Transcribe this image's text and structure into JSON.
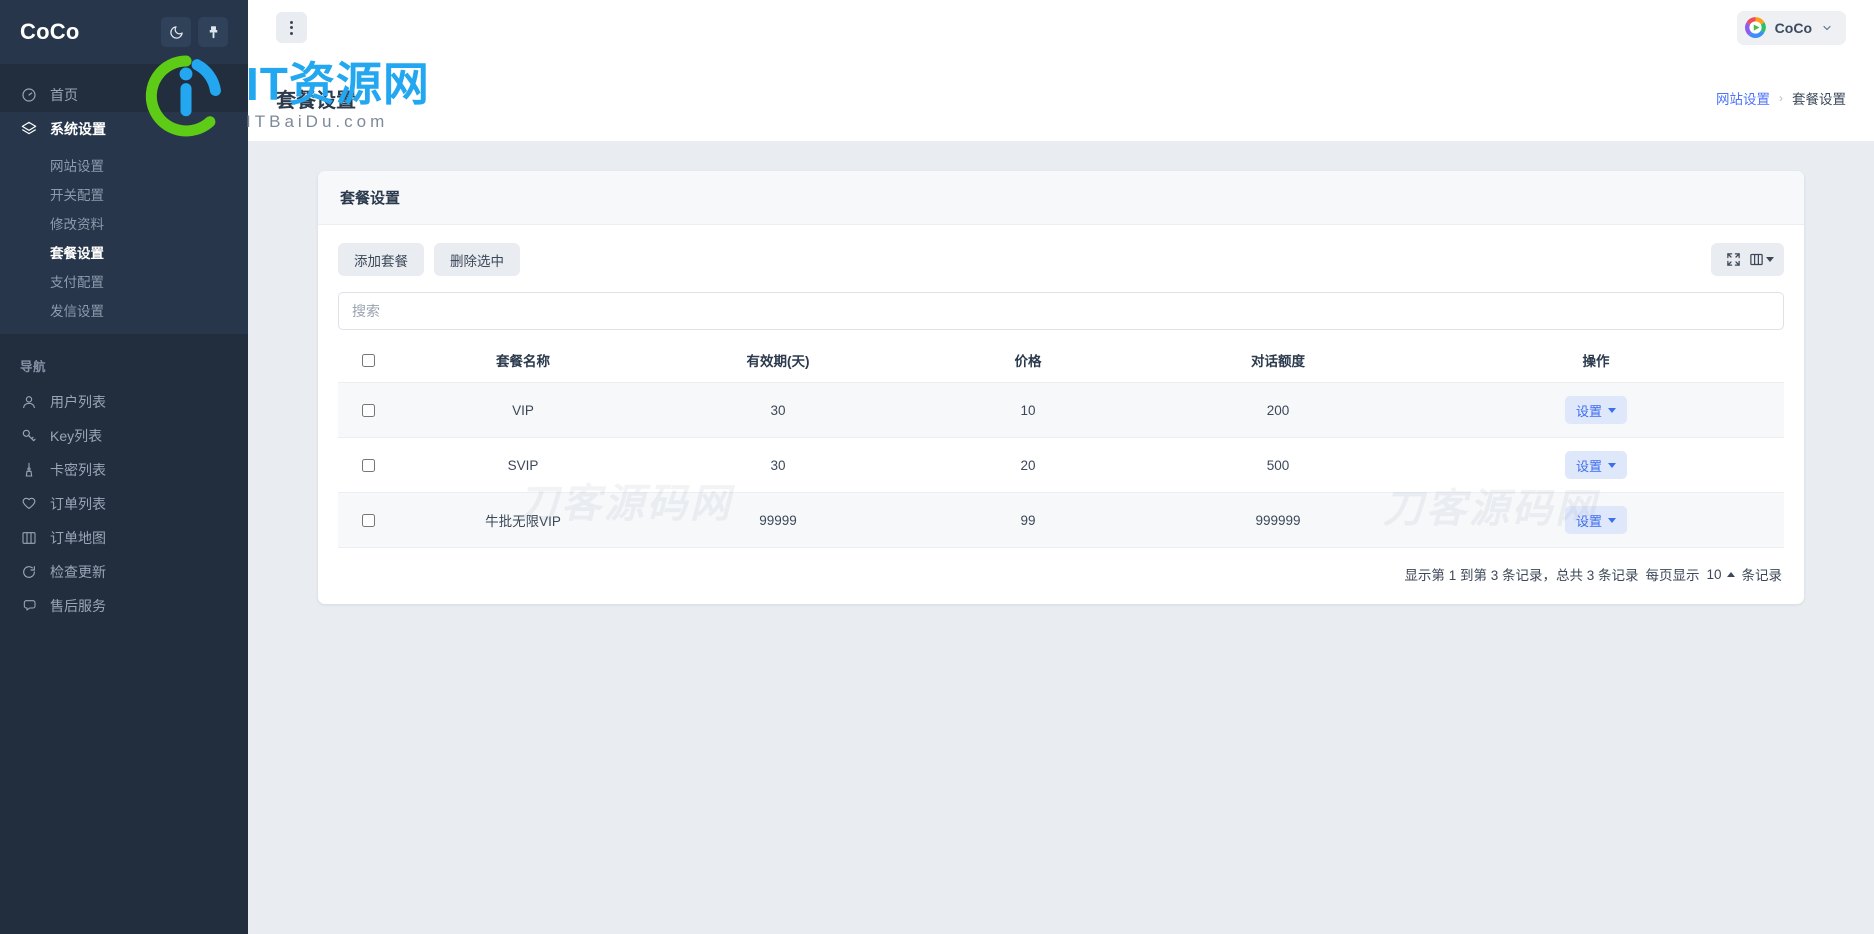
{
  "sidebar": {
    "brand": "CoCo",
    "brand_buttons": [
      {
        "name": "moon-icon",
        "label": "深色模式"
      },
      {
        "name": "paint-icon",
        "label": "主题配置"
      }
    ],
    "items": [
      {
        "label": "首页",
        "icon": "gauge-icon",
        "active": false
      },
      {
        "label": "系统设置",
        "icon": "layers-icon",
        "active": true
      }
    ],
    "subitems": [
      {
        "label": "网站设置",
        "active": false
      },
      {
        "label": "开关配置",
        "active": false
      },
      {
        "label": "修改资料",
        "active": false
      },
      {
        "label": "套餐设置",
        "active": true
      },
      {
        "label": "支付配置",
        "active": false
      },
      {
        "label": "发信设置",
        "active": false
      }
    ],
    "section_title": "导航",
    "nav_items": [
      {
        "label": "用户列表",
        "icon": "user-icon"
      },
      {
        "label": "Key列表",
        "icon": "key-icon"
      },
      {
        "label": "卡密列表",
        "icon": "card-icon"
      },
      {
        "label": "订单列表",
        "icon": "heart-icon"
      },
      {
        "label": "订单地图",
        "icon": "book-icon"
      },
      {
        "label": "检查更新",
        "icon": "refresh-icon"
      },
      {
        "label": "售后服务",
        "icon": "chat-icon"
      }
    ]
  },
  "topbar": {
    "menu_icon": "kebab-menu-icon",
    "user_name": "CoCo",
    "user_caret": "chevron-down-icon"
  },
  "page": {
    "title": "套餐设置",
    "breadcrumb": {
      "parent": "网站设置",
      "separator": "›",
      "current": "套餐设置"
    }
  },
  "card": {
    "title": "套餐设置",
    "toolbar": {
      "add_label": "添加套餐",
      "delete_label": "删除选中",
      "fullscreen_icon": "fullscreen-icon",
      "columns_icon": "columns-icon"
    },
    "search": {
      "placeholder": "搜索",
      "value": ""
    },
    "table": {
      "columns": [
        "",
        "套餐名称",
        "有效期(天)",
        "价格",
        "对话额度",
        "操作"
      ],
      "rows": [
        {
          "name": "VIP",
          "days": "30",
          "price": "10",
          "quota": "200",
          "action": "设置"
        },
        {
          "name": "SVIP",
          "days": "30",
          "price": "20",
          "quota": "500",
          "action": "设置"
        },
        {
          "name": "牛批无限VIP",
          "days": "99999",
          "price": "99",
          "quota": "999999",
          "action": "设置"
        }
      ]
    },
    "pager": {
      "summary": "显示第 1 到第 3 条记录，总共 3 条记录",
      "per_page_label": "每页显示",
      "per_page_value": "10",
      "per_page_suffix": "条记录"
    }
  },
  "watermarks": {
    "logo_title": "IT资源网",
    "logo_sub": "ITBaiDu.com",
    "ghost_left": "刀客源码网",
    "ghost_right": "刀客源码网"
  },
  "colors": {
    "sidebar_bg": "#222e3e",
    "sidebar_active": "#27364a",
    "accent_blue": "#4e73f8",
    "content_bg": "#e9ecf1",
    "action_blue_bg": "#dfe7fb",
    "action_blue_fg": "#3c6ef0",
    "logo_green": "#5ecc16",
    "logo_blue": "#22a7f0"
  }
}
